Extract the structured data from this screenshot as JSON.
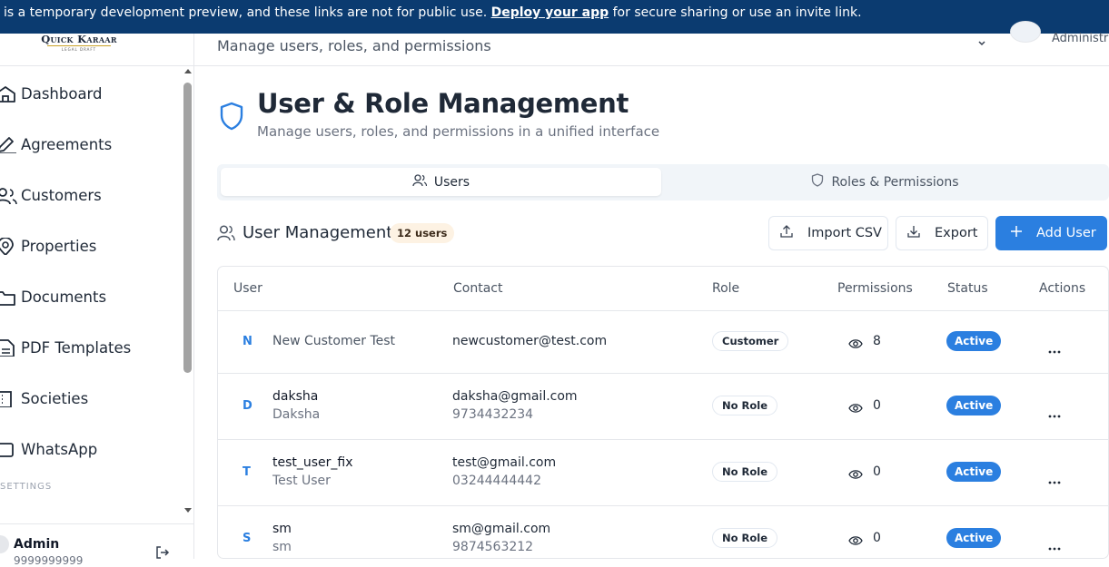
{
  "banner": {
    "text_before": "is a temporary development preview, and these links are not for public use. ",
    "link": "Deploy your app",
    "text_after": " for secure sharing or use an invite link."
  },
  "logo": {
    "line1": "Quick Karaar",
    "line2": "LEGAL DRAFT"
  },
  "sidebar": {
    "items": [
      {
        "label": "Dashboard",
        "icon": "home-icon"
      },
      {
        "label": "Agreements",
        "icon": "pen-icon"
      },
      {
        "label": "Customers",
        "icon": "users-icon"
      },
      {
        "label": "Properties",
        "icon": "map-pin-icon"
      },
      {
        "label": "Documents",
        "icon": "folder-icon"
      },
      {
        "label": "PDF Templates",
        "icon": "file-icon"
      },
      {
        "label": "Societies",
        "icon": "building-icon"
      },
      {
        "label": "WhatsApp",
        "icon": "message-icon"
      }
    ],
    "section_label": "SETTINGS",
    "user": {
      "name": "Admin",
      "phone": "9999999999"
    }
  },
  "topbar": {
    "subtitle": "Manage users, roles, and permissions",
    "role": "Administrator"
  },
  "page": {
    "title": "User & Role Management",
    "description": "Manage users, roles, and permissions in a unified interface"
  },
  "tabs": [
    {
      "label": "Users",
      "active": true
    },
    {
      "label": "Roles & Permissions",
      "active": false
    }
  ],
  "user_management": {
    "title": "User Management",
    "count_badge": "12 users",
    "import_label": "Import CSV",
    "export_label": "Export",
    "add_label": "Add User"
  },
  "table": {
    "columns": [
      "User",
      "Contact",
      "Role",
      "Permissions",
      "Status",
      "Actions"
    ],
    "rows": [
      {
        "initial": "N",
        "name": "New Customer Test",
        "display": "",
        "email": "newcustomer@test.com",
        "phone": "",
        "role": "Customer",
        "permissions": "8",
        "status": "Active"
      },
      {
        "initial": "D",
        "name": "daksha",
        "display": "Daksha",
        "email": "daksha@gmail.com",
        "phone": "9734432234",
        "role": "No Role",
        "permissions": "0",
        "status": "Active"
      },
      {
        "initial": "T",
        "name": "test_user_fix",
        "display": "Test User",
        "email": "test@gmail.com",
        "phone": "03244444442",
        "role": "No Role",
        "permissions": "0",
        "status": "Active"
      },
      {
        "initial": "S",
        "name": "sm",
        "display": "sm",
        "email": "sm@gmail.com",
        "phone": "9874563212",
        "role": "No Role",
        "permissions": "0",
        "status": "Active"
      }
    ]
  },
  "colors": {
    "banner": "#0b3b70",
    "accent": "#2b7fe0",
    "badge_bg": "#fdf2e3"
  }
}
